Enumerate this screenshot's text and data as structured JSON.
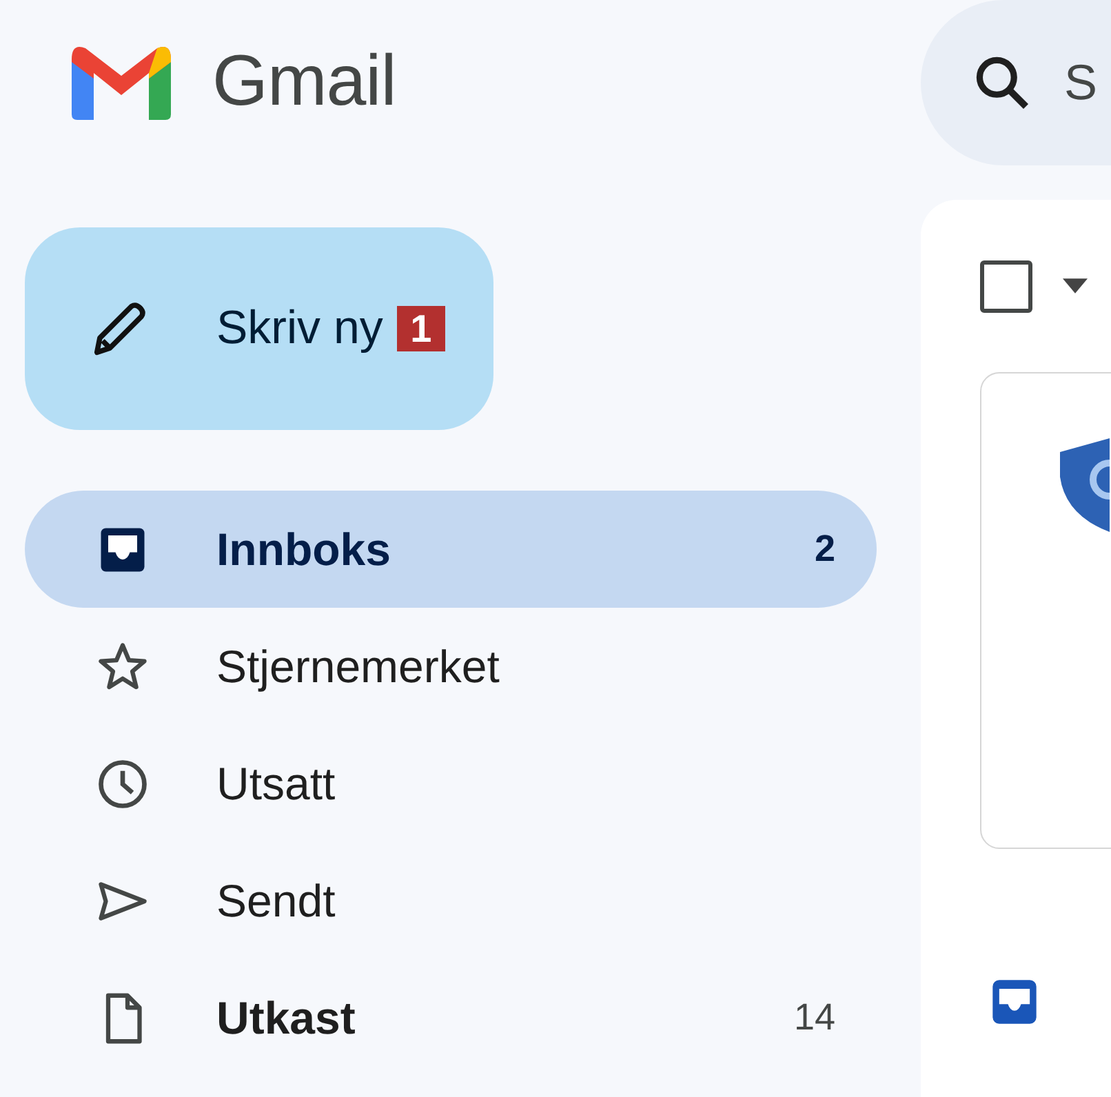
{
  "app": {
    "name": "Gmail"
  },
  "compose": {
    "label": "Skriv ny",
    "badge": "1"
  },
  "nav": [
    {
      "kind": "inbox",
      "label": "Innboks",
      "count": "2",
      "selected": true,
      "unread": true
    },
    {
      "kind": "star",
      "label": "Stjernemerket",
      "selected": false,
      "unread": false
    },
    {
      "kind": "clock",
      "label": "Utsatt",
      "selected": false,
      "unread": false
    },
    {
      "kind": "send",
      "label": "Sendt",
      "selected": false,
      "unread": false
    },
    {
      "kind": "draft",
      "label": "Utkast",
      "count": "14",
      "selected": false,
      "unread": true
    }
  ],
  "search": {
    "placeholder": "S"
  },
  "toolbar": {
    "select_all": {
      "checked": false
    }
  }
}
